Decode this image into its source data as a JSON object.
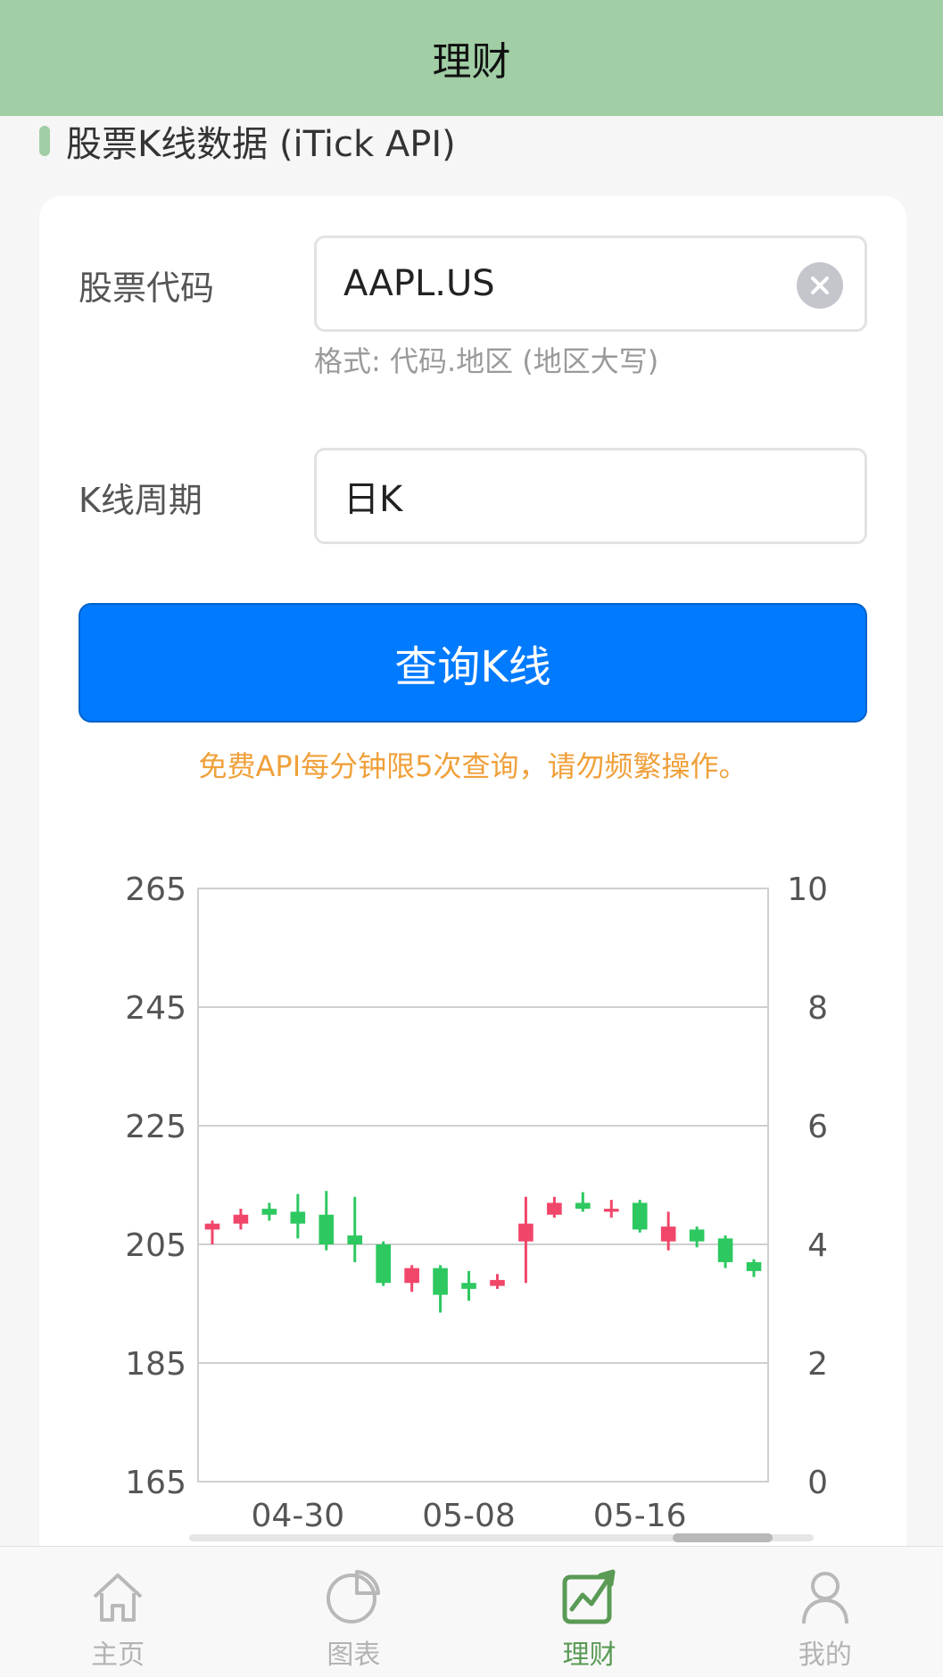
{
  "header": {
    "title": "理财"
  },
  "section": {
    "title": "股票K线数据 (iTick API)"
  },
  "form": {
    "code_label": "股票代码",
    "code_value": "AAPL.US",
    "code_hint": "格式: 代码.地区 (地区大写)",
    "period_label": "K线周期",
    "period_value": "日K",
    "query_button": "查询K线",
    "warning": "免费API每分钟限5次查询，请勿频繁操作。"
  },
  "colors": {
    "up": "#f0466a",
    "down": "#2ec860",
    "accent": "#007aff",
    "header": "#a1cea5",
    "warning": "#f0a03a"
  },
  "chart_data": {
    "type": "candlestick",
    "title": "",
    "ylim": [
      165,
      265
    ],
    "y_ticks": [
      "265",
      "245",
      "225",
      "205",
      "185",
      "165"
    ],
    "y2lim": [
      0,
      10
    ],
    "y2_ticks": [
      "10",
      "8",
      "6",
      "4",
      "2",
      "0"
    ],
    "x_ticks": [
      "04-30",
      "05-08",
      "05-16"
    ],
    "grid": true,
    "candles": [
      {
        "o": 207.5,
        "c": 208.5,
        "h": 209,
        "l": 205
      },
      {
        "o": 208.5,
        "c": 210,
        "h": 211,
        "l": 207.5
      },
      {
        "o": 211,
        "c": 210,
        "h": 212,
        "l": 209
      },
      {
        "o": 210.5,
        "c": 208.5,
        "h": 213.5,
        "l": 206
      },
      {
        "o": 210,
        "c": 205,
        "h": 214,
        "l": 204
      },
      {
        "o": 206.5,
        "c": 205,
        "h": 213,
        "l": 202
      },
      {
        "o": 205,
        "c": 198.5,
        "h": 205.5,
        "l": 198
      },
      {
        "o": 198.5,
        "c": 201,
        "h": 201.5,
        "l": 197
      },
      {
        "o": 201,
        "c": 196.5,
        "h": 201.5,
        "l": 193.5
      },
      {
        "o": 198.5,
        "c": 197.5,
        "h": 200.5,
        "l": 195.5
      },
      {
        "o": 198,
        "c": 199,
        "h": 200,
        "l": 197.5
      },
      {
        "o": 205.5,
        "c": 208.5,
        "h": 213,
        "l": 198.5
      },
      {
        "o": 210,
        "c": 212,
        "h": 213,
        "l": 209.5
      },
      {
        "o": 212,
        "c": 211,
        "h": 213.8,
        "l": 210.5
      },
      {
        "o": 210.5,
        "c": 211,
        "h": 212.5,
        "l": 209.5
      },
      {
        "o": 212,
        "c": 207.5,
        "h": 212.5,
        "l": 207
      },
      {
        "o": 205.5,
        "c": 208,
        "h": 210.5,
        "l": 204
      },
      {
        "o": 207.5,
        "c": 205.5,
        "h": 208,
        "l": 204.5
      },
      {
        "o": 206,
        "c": 202,
        "h": 206.5,
        "l": 201
      },
      {
        "o": 202,
        "c": 200.5,
        "h": 202.5,
        "l": 199.5
      }
    ]
  },
  "tabs": [
    {
      "label": "主页",
      "icon": "home-icon",
      "active": false
    },
    {
      "label": "图表",
      "icon": "pie-chart-icon",
      "active": false
    },
    {
      "label": "理财",
      "icon": "finance-chart-icon",
      "active": true
    },
    {
      "label": "我的",
      "icon": "user-icon",
      "active": false
    }
  ]
}
